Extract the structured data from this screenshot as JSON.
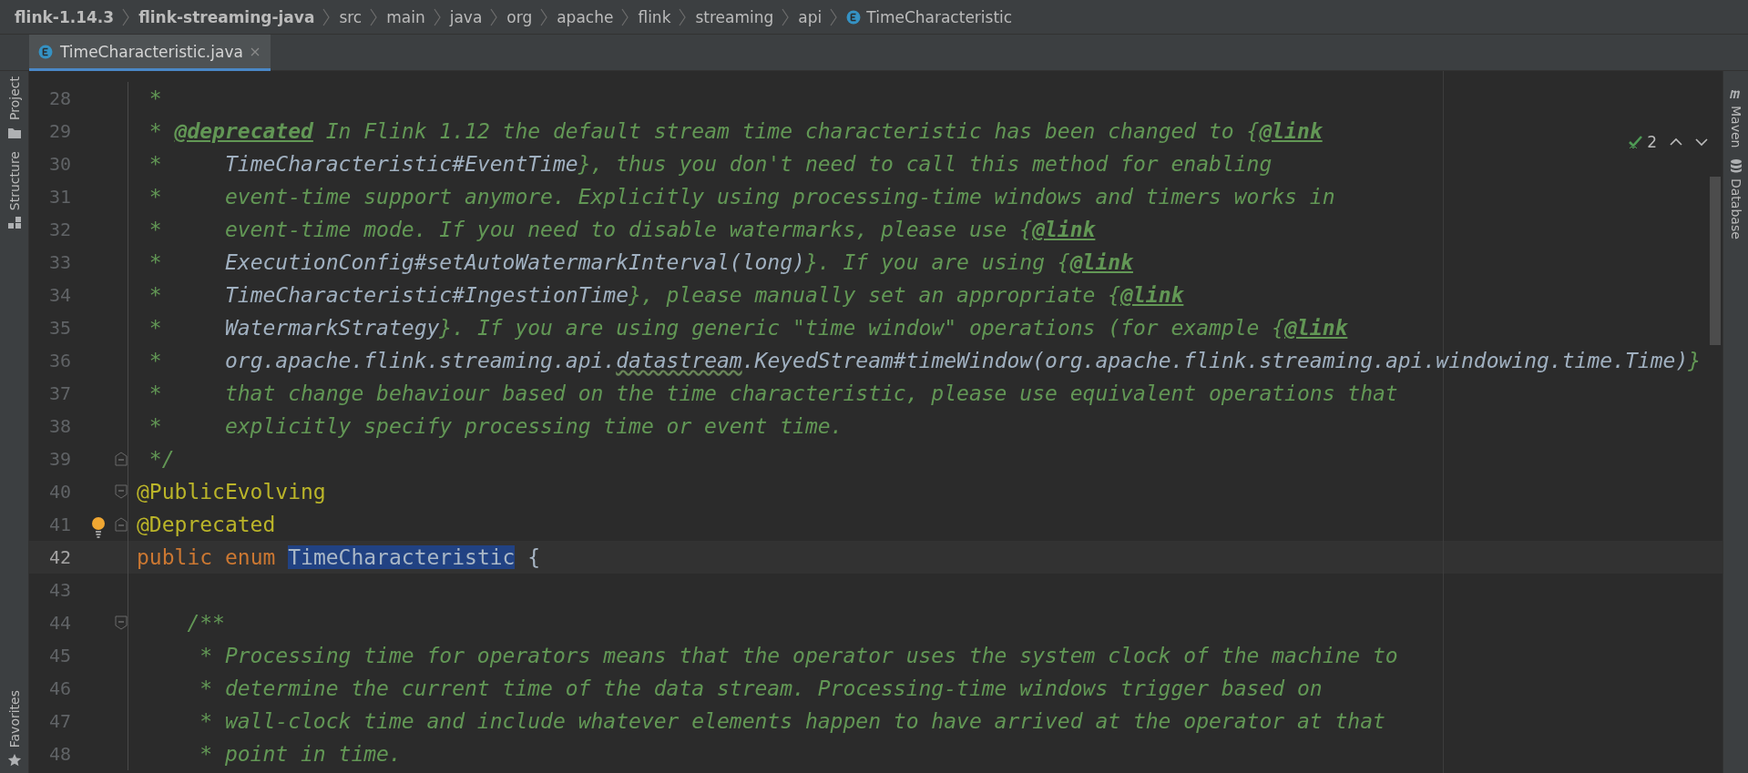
{
  "breadcrumbs": [
    {
      "label": "flink-1.14.3",
      "kind": "module"
    },
    {
      "label": "flink-streaming-java",
      "kind": "module"
    },
    {
      "label": "src",
      "kind": "dir"
    },
    {
      "label": "main",
      "kind": "dir"
    },
    {
      "label": "java",
      "kind": "dir"
    },
    {
      "label": "org",
      "kind": "dir"
    },
    {
      "label": "apache",
      "kind": "dir"
    },
    {
      "label": "flink",
      "kind": "dir"
    },
    {
      "label": "streaming",
      "kind": "dir"
    },
    {
      "label": "api",
      "kind": "dir"
    },
    {
      "label": "TimeCharacteristic",
      "kind": "enum"
    }
  ],
  "left_tools": [
    {
      "label": "Project",
      "kind": "folder"
    },
    {
      "label": "Structure",
      "kind": "structure"
    },
    {
      "label": "Favorites",
      "kind": "star"
    }
  ],
  "right_tools": [
    {
      "label": "Maven",
      "kind": "maven"
    },
    {
      "label": "Database",
      "kind": "database"
    }
  ],
  "tabs": [
    {
      "label": "TimeCharacteristic.java",
      "selected": true
    }
  ],
  "inspection": {
    "count": "2"
  },
  "lines": [
    {
      "number": "28",
      "current": false,
      "segments": [
        {
          "text": " *",
          "kind": "comment"
        }
      ]
    },
    {
      "number": "29",
      "current": false,
      "segments": [
        {
          "text": " * ",
          "kind": "comment"
        },
        {
          "text": "@deprecated",
          "kind": "tag"
        },
        {
          "text": " In Flink 1.12 the default stream time characteristic has been changed to {",
          "kind": "comment"
        },
        {
          "text": "@link",
          "kind": "tag"
        }
      ]
    },
    {
      "number": "30",
      "current": false,
      "segments": [
        {
          "text": " *     ",
          "kind": "comment"
        },
        {
          "text": "TimeCharacteristic#EventTime",
          "kind": "ref"
        },
        {
          "text": "}, thus you don't need to call this method for enabling",
          "kind": "comment"
        }
      ]
    },
    {
      "number": "31",
      "current": false,
      "segments": [
        {
          "text": " *     event-time support anymore. Explicitly using processing-time windows and timers works in",
          "kind": "comment"
        }
      ]
    },
    {
      "number": "32",
      "current": false,
      "segments": [
        {
          "text": " *     event-time mode. If you need to disable watermarks, please use {",
          "kind": "comment"
        },
        {
          "text": "@link",
          "kind": "tag"
        }
      ]
    },
    {
      "number": "33",
      "current": false,
      "segments": [
        {
          "text": " *     ",
          "kind": "comment"
        },
        {
          "text": "ExecutionConfig#setAutoWatermarkInterval(long)",
          "kind": "ref"
        },
        {
          "text": "}. If you are using {",
          "kind": "comment"
        },
        {
          "text": "@link",
          "kind": "tag"
        }
      ]
    },
    {
      "number": "34",
      "current": false,
      "segments": [
        {
          "text": " *     ",
          "kind": "comment"
        },
        {
          "text": "TimeCharacteristic#IngestionTime",
          "kind": "ref"
        },
        {
          "text": "}, please manually set an appropriate {",
          "kind": "comment"
        },
        {
          "text": "@link",
          "kind": "tag"
        }
      ]
    },
    {
      "number": "35",
      "current": false,
      "segments": [
        {
          "text": " *     ",
          "kind": "comment"
        },
        {
          "text": "WatermarkStrategy",
          "kind": "ref"
        },
        {
          "text": "}. If you are using generic \"time window\" operations (for example {",
          "kind": "comment"
        },
        {
          "text": "@link",
          "kind": "tag"
        }
      ]
    },
    {
      "number": "36",
      "current": false,
      "segments": [
        {
          "text": " *     ",
          "kind": "comment"
        },
        {
          "text": "org.apache.flink.streaming.api.",
          "kind": "ref"
        },
        {
          "text": "datastream",
          "kind": "typo"
        },
        {
          "text": ".KeyedStream#timeWindow(org.apache.flink.streaming.api.windowing.time.Time)",
          "kind": "ref"
        },
        {
          "text": "}",
          "kind": "comment"
        }
      ]
    },
    {
      "number": "37",
      "current": false,
      "segments": [
        {
          "text": " *     that change behaviour based on the time characteristic, please use equivalent operations that",
          "kind": "comment"
        }
      ]
    },
    {
      "number": "38",
      "current": false,
      "segments": [
        {
          "text": " *     explicitly specify processing time or event time.",
          "kind": "comment"
        }
      ]
    },
    {
      "number": "39",
      "current": false,
      "kind": "fold-end",
      "segments": [
        {
          "text": " */",
          "kind": "comment"
        }
      ]
    },
    {
      "number": "40",
      "current": false,
      "kind": "fold-start",
      "segments": [
        {
          "text": "@PublicEvolving",
          "kind": "annotation"
        }
      ]
    },
    {
      "number": "41",
      "current": false,
      "kind": "fold-end",
      "bulb": true,
      "segments": [
        {
          "text": "@Deprecated",
          "kind": "annotation"
        }
      ]
    },
    {
      "number": "42",
      "current": true,
      "segments": [
        {
          "text": "public ",
          "kind": "keyword"
        },
        {
          "text": "enum ",
          "kind": "keyword"
        },
        {
          "text": "TimeCharacteristic",
          "kind": "selected"
        },
        {
          "text": " {",
          "kind": "plain"
        }
      ]
    },
    {
      "number": "43",
      "current": false
    },
    {
      "number": "44",
      "current": false,
      "kind": "fold-start",
      "segments": [
        {
          "text": "    /**",
          "kind": "comment"
        }
      ]
    },
    {
      "number": "45",
      "current": false,
      "segments": [
        {
          "text": "     * Processing time for operators means that the operator uses the system clock of the machine to",
          "kind": "comment"
        }
      ]
    },
    {
      "number": "46",
      "current": false,
      "segments": [
        {
          "text": "     * determine the current time of the data stream. Processing-time windows trigger based on",
          "kind": "comment"
        }
      ]
    },
    {
      "number": "47",
      "current": false,
      "segments": [
        {
          "text": "     * wall-clock time and include whatever elements happen to have arrived at the operator at that",
          "kind": "comment"
        }
      ]
    },
    {
      "number": "48",
      "current": false,
      "segments": [
        {
          "text": "     * point in time.",
          "kind": "comment"
        }
      ]
    }
  ]
}
